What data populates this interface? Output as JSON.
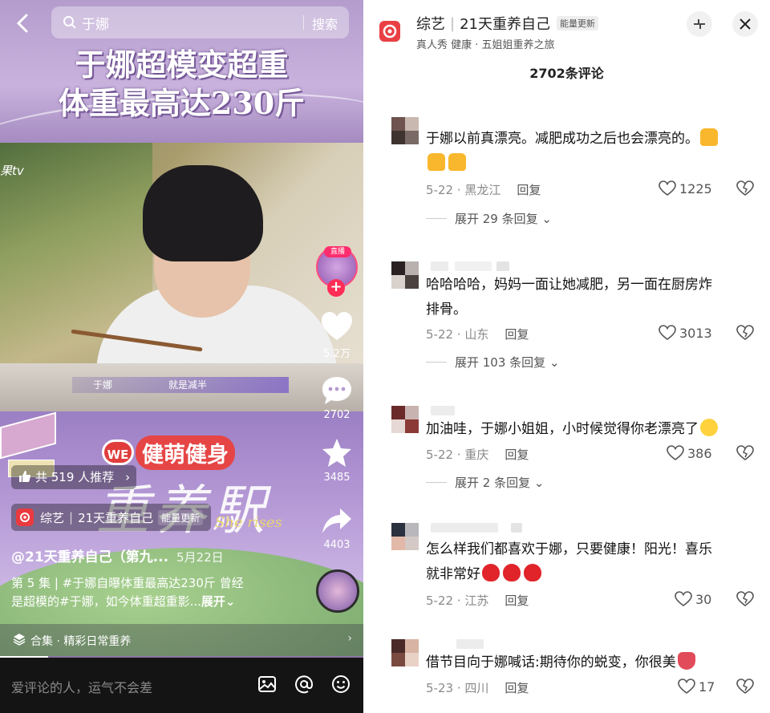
{
  "left": {
    "search": {
      "query": "于娜",
      "button": "搜索"
    },
    "banner": {
      "line1": "于娜超模变超重",
      "line2": "体重最高达230斤"
    },
    "watermark": "果tv",
    "subtitle": {
      "name": "于娜",
      "text": "就是减半"
    },
    "brand": {
      "logo": "WE",
      "text": "健萌健身"
    },
    "script": "重养駅",
    "script_en": "She rises",
    "live_label": "直播",
    "actions": {
      "like": "5.2万",
      "comment": "2702",
      "favorite": "3485",
      "share": "4403"
    },
    "recommend": "共 519 人推荐",
    "show": {
      "category": "综艺",
      "title": "21天重养自己",
      "badge": "能量更新"
    },
    "author": "@21天重养自己（第九...",
    "date": "5月22日",
    "description_line1": "第 5 集 | #于娜自曝体重最高达230斤 曾经",
    "description_line2": "是超模的#于娜，如今体重超重影...",
    "description_more": "展开",
    "collection": "合集 · 精彩日常重养",
    "comment_placeholder": "爱评论的人，运气不会差"
  },
  "right": {
    "header": {
      "category": "综艺",
      "title": "21天重养自己",
      "badge": "能量更新",
      "subtitle": "真人秀 健康 · 五姐姐重养之旅"
    },
    "comment_count": "2702条评论",
    "reply_label": "回复",
    "comments": [
      {
        "line1": "于娜以前真漂亮。减肥成功之后也会漂亮的。",
        "date_loc": "5-22 · 黑龙江",
        "likes": "1225",
        "expand": "展开 29 条回复"
      },
      {
        "line1": "哈哈哈哈，妈妈一面让她减肥，另一面在厨房炸",
        "line2": "排骨。",
        "date_loc": "5-22 · 山东",
        "likes": "3013",
        "expand": "展开 103 条回复"
      },
      {
        "line1": "加油哇，于娜小姐姐，小时候觉得你老漂亮了",
        "date_loc": "5-22 · 重庆",
        "likes": "386",
        "expand": "展开 2 条回复"
      },
      {
        "line1": "怎么样我们都喜欢于娜，只要健康！阳光！喜乐",
        "line2": "就非常好",
        "date_loc": "5-22 · 江苏",
        "likes": "30"
      },
      {
        "line1": "借节目向于娜喊话:期待你的蜕变，你很美",
        "date_loc": "5-23 · 四川",
        "likes": "17"
      }
    ]
  }
}
